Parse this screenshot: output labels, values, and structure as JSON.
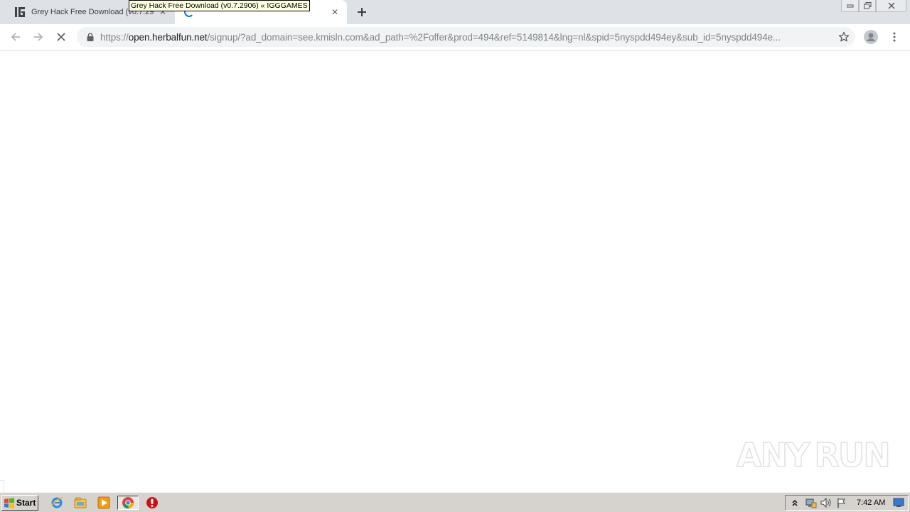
{
  "browser": {
    "tabs": [
      {
        "title": "Grey Hack Free Download (v0.7.29",
        "favicon": "igg-games-icon",
        "state": "inactive"
      },
      {
        "title": "",
        "favicon": "loading-spinner-icon",
        "state": "active-loading"
      }
    ],
    "tooltip": "Grey Hack Free Download (v0.7.2906) « IGGGAMES",
    "new_tab_icon": "plus-icon",
    "window_controls": [
      "minimize-icon",
      "maximize-icon",
      "close-icon"
    ],
    "toolbar": {
      "back_icon": "back-arrow-icon",
      "forward_icon": "forward-arrow-icon",
      "stop_icon": "stop-loading-icon",
      "lock_icon": "lock-icon",
      "url_scheme": "https://",
      "url_host": "open.herbalfun.net",
      "url_rest": "/signup/?ad_domain=see.kmisln.com&ad_path=%2Foffer&prod=494&ref=5149814&lng=nl&spid=5nyspdd494ey&sub_id=5nyspdd494e...",
      "bookmark_icon": "star-icon",
      "profile_icon": "avatar-icon",
      "menu_icon": "kebab-menu-icon"
    }
  },
  "watermark": {
    "left": "ANY",
    "right": "RUN"
  },
  "taskbar": {
    "start_label": "Start",
    "quick_launch": [
      "internet-explorer-icon",
      "windows-explorer-icon",
      "media-player-icon",
      "chrome-icon",
      "opera-icon"
    ],
    "tray_icons": [
      "show-hidden-icons-icon",
      "network-icon",
      "volume-icon",
      "action-center-flag-icon"
    ],
    "clock": "7:42 AM",
    "show_desktop_icon": "show-desktop-icon"
  },
  "colors": {
    "tabstrip": "#dee1e6",
    "accent": "#1a73e8",
    "taskbar": "#d6d3ce"
  }
}
